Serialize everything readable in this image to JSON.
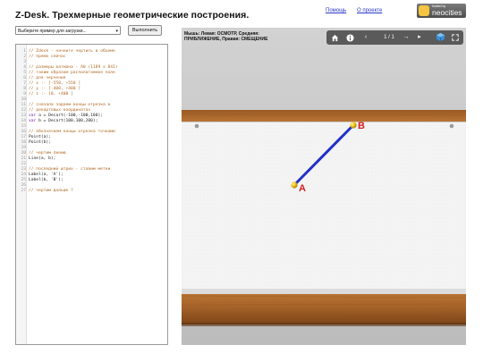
{
  "header": {
    "title": "Z-Desk. Трехмерные геометрические построения.",
    "help_link": "Помощь",
    "about_link": "О проекте",
    "logo_small": "hosted by",
    "logo_big": "neocities"
  },
  "controls": {
    "example_select": "Выберите пример для загрузки...",
    "run_button": "Выполнить"
  },
  "editor": {
    "lines": [
      {
        "n": "1",
        "text": "// Zdesk - начните чертить в объеме",
        "type": "comment"
      },
      {
        "n": "2",
        "text": "// прямо сейчас",
        "type": "comment"
      },
      {
        "n": "3",
        "text": "",
        "type": "code"
      },
      {
        "n": "4",
        "text": "// размеры ватмана - А0 (1189 х 841)",
        "type": "comment"
      },
      {
        "n": "5",
        "text": "// таким образом располагаемое поле",
        "type": "comment"
      },
      {
        "n": "6",
        "text": "// для черчения",
        "type": "comment"
      },
      {
        "n": "7",
        "text": "// x :- [-550, +550 ]",
        "type": "comment"
      },
      {
        "n": "8",
        "text": "// y :- [-400, +400 ]",
        "type": "comment"
      },
      {
        "n": "9",
        "text": "// z :- [0, +400 ]",
        "type": "comment"
      },
      {
        "n": "10",
        "text": "",
        "type": "code"
      },
      {
        "n": "11",
        "text": "// сначала задаем концы отрезка в",
        "type": "comment"
      },
      {
        "n": "12",
        "text": "// декартовых координатах",
        "type": "comment"
      },
      {
        "n": "13",
        "text": "var a = Decart(-100,-100,100);",
        "type": "code"
      },
      {
        "n": "14",
        "text": "var b = Decart(100,100,200);",
        "type": "code"
      },
      {
        "n": "15",
        "text": "",
        "type": "code"
      },
      {
        "n": "16",
        "text": "// обозначаем концы отрезка точками",
        "type": "comment"
      },
      {
        "n": "17",
        "text": "Point(a);",
        "type": "code"
      },
      {
        "n": "18",
        "text": "Point(b);",
        "type": "code"
      },
      {
        "n": "19",
        "text": "",
        "type": "code"
      },
      {
        "n": "20",
        "text": "// чертим линию",
        "type": "comment"
      },
      {
        "n": "21",
        "text": "Line(a, b);",
        "type": "code"
      },
      {
        "n": "22",
        "text": "",
        "type": "code"
      },
      {
        "n": "23",
        "text": "// последний штрих - ставим метки",
        "type": "comment"
      },
      {
        "n": "24",
        "text": "Label(a, 'A');",
        "type": "code"
      },
      {
        "n": "25",
        "text": "Label(b, 'B');",
        "type": "code"
      },
      {
        "n": "26",
        "text": "",
        "type": "code"
      },
      {
        "n": "27",
        "text": "// чертим дальше ?",
        "type": "comment"
      }
    ]
  },
  "viewer": {
    "status_line1": "Мышь: Левая: ОСМОТР, Средняя:",
    "status_line2": "ПРИБЛИЖЕНИЕ, Правая: СМЕЩЕНИЕ",
    "page_counter": "1 / 1",
    "label_a": "A",
    "label_b": "B",
    "colors": {
      "line": "#2230c8",
      "point": "#f2c21a",
      "label": "#d42020",
      "paper": "#f4f4f4",
      "wood": "#a8652a"
    },
    "icons": [
      "home-icon",
      "info-icon",
      "prev-icon",
      "next-icon",
      "play-icon",
      "3d-cube-icon",
      "fullscreen-icon"
    ]
  }
}
